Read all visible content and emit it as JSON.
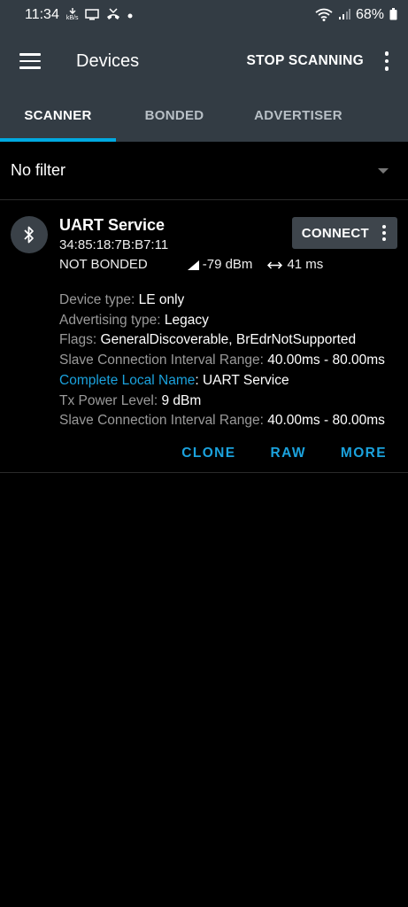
{
  "status_bar": {
    "time": "11:34",
    "kbs_label": "kB/s",
    "battery": "68%"
  },
  "app_bar": {
    "title": "Devices",
    "action": "STOP SCANNING"
  },
  "tabs": [
    {
      "label": "SCANNER",
      "active": true
    },
    {
      "label": "BONDED",
      "active": false
    },
    {
      "label": "ADVERTISER",
      "active": false
    }
  ],
  "filter": {
    "label": "No filter"
  },
  "device": {
    "name": "UART Service",
    "mac": "34:85:18:7B:B7:11",
    "bond_state": "NOT BONDED",
    "rssi": "-79 dBm",
    "interval": "41 ms",
    "connect_label": "CONNECT",
    "details": [
      {
        "key": "Device type: ",
        "value": "LE only",
        "highlight": false
      },
      {
        "key": "Advertising type: ",
        "value": "Legacy",
        "highlight": false
      },
      {
        "key": "Flags: ",
        "value": "GeneralDiscoverable, BrEdrNotSupported",
        "highlight": false
      },
      {
        "key": "Slave Connection Interval Range: ",
        "value": "40.00ms - 80.00ms",
        "highlight": false
      },
      {
        "key": "Complete Local Name",
        "value": "UART Service",
        "highlight": true
      },
      {
        "key": "Tx Power Level: ",
        "value": "9 dBm",
        "highlight": false
      },
      {
        "key": "Slave Connection Interval Range: ",
        "value": "40.00ms - 80.00ms",
        "highlight": false
      }
    ],
    "actions": {
      "clone": "CLONE",
      "raw": "RAW",
      "more": "MORE"
    }
  },
  "colors": {
    "accent": "#00a9e0",
    "bar_bg": "#333c44"
  }
}
